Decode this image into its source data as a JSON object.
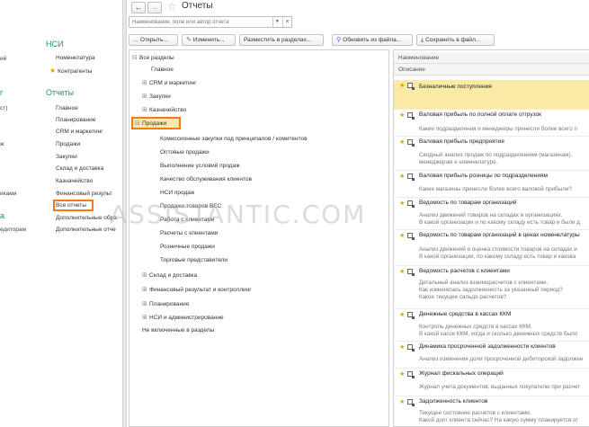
{
  "left_nav": {
    "stubs": [
      "ий",
      "г",
      "ст)",
      "ж",
      "иками",
      "а",
      "едиторам"
    ],
    "sections": [
      {
        "title": "НСИ",
        "items": [
          "Номенклатура",
          "Контрагенты"
        ]
      },
      {
        "title": "Отчеты",
        "items": [
          "Главное",
          "Планирование",
          "CRM и маркетинг",
          "Продажи",
          "Закупки",
          "Склад и доставка",
          "Казначейство",
          "Финансовый результ",
          "Все отчеты",
          "Дополнительные обра",
          "Дополнительные отче"
        ]
      }
    ]
  },
  "header": {
    "back_icon": "←",
    "forward_icon": "→",
    "star_icon": "☆",
    "title": "Отчеты"
  },
  "search": {
    "placeholder": "Наименование, поле или автор отчета",
    "dropdown_icon": "▼",
    "clear_icon": "×"
  },
  "toolbar": {
    "buttons": [
      {
        "icon": "...",
        "label": "Открыть..."
      },
      {
        "icon": "✎",
        "label": "Изменить..."
      },
      {
        "icon": "",
        "label": "Разместить в разделах..."
      },
      {
        "icon": "⚲",
        "label": "Обновить из файла..."
      },
      {
        "icon": "⤓",
        "label": "Сохранить в файл..."
      }
    ]
  },
  "tree": {
    "root": "Все разделы",
    "items": [
      {
        "label": "Главное",
        "expander": ""
      },
      {
        "label": "CRM и маркетинг",
        "expander": "⊞"
      },
      {
        "label": "Закупки",
        "expander": "⊞"
      },
      {
        "label": "Казначейство",
        "expander": "⊞"
      },
      {
        "label": "Продажи",
        "expander": "⊟"
      },
      {
        "label": "Комиссионные закупки под принципалов / комитентов",
        "expander": ""
      },
      {
        "label": "Оптовые продажи",
        "expander": ""
      },
      {
        "label": "Выполнение условий продаж",
        "expander": ""
      },
      {
        "label": "Качество обслуживания клиентов",
        "expander": ""
      },
      {
        "label": "НСИ продаж",
        "expander": ""
      },
      {
        "label": "Продажи товаров ВЕС",
        "expander": ""
      },
      {
        "label": "Работа с клиентами",
        "expander": ""
      },
      {
        "label": "Расчеты с клиентами",
        "expander": ""
      },
      {
        "label": "Розничные продажи",
        "expander": ""
      },
      {
        "label": "Торговые представители",
        "expander": ""
      },
      {
        "label": "Склад и доставка",
        "expander": "⊞"
      },
      {
        "label": "Финансовый результат и контроллинг",
        "expander": "⊞"
      },
      {
        "label": "Планирование",
        "expander": "⊞"
      },
      {
        "label": "НСИ и администрирование",
        "expander": "⊞"
      },
      {
        "label": "Не включенные в разделы",
        "expander": ""
      }
    ]
  },
  "reports": {
    "col_name": "Наименование",
    "col_desc": "Описание",
    "items": [
      {
        "title": "Безналичные поступления",
        "desc": []
      },
      {
        "title": "Валовая прибыль по полной оплате отгрузок",
        "desc": [
          "Какие подразделения и менеджеры принесли более всего п"
        ]
      },
      {
        "title": "Валовая прибыль предприятия",
        "desc": [
          "Сводный анализ продаж по подразделениям (магазинам),",
          "менеджерам и номенклатуре."
        ]
      },
      {
        "title": "Валовая прибыль розницы по подразделениям",
        "desc": [
          "Какие магазины принесли более всего валовой прибыли?"
        ]
      },
      {
        "title": "Ведомость по товарам организаций",
        "desc": [
          "Анализ движений товаров на складах и организациях.",
          "В какой организации и по какому складу есть товар и были д"
        ]
      },
      {
        "title": "Ведомость по товарам организаций в ценах номенклатуры",
        "desc": [
          "Анализ движений и оценка стоимости товаров на складах и",
          "В какой организации, по какому складу есть товар и какова"
        ]
      },
      {
        "title": "Ведомость расчетов с клиентами",
        "desc": [
          "Детальный анализ взаиморасчетов с клиентами.",
          "Как изменялась задолженность за указанный период?",
          "Какое текущее сальдо расчетов?"
        ]
      },
      {
        "title": "Денежные средства в кассах ККМ",
        "desc": [
          "Контроль денежных средств в кассах ККМ.",
          "В какой кассе ККМ, когда и сколько денежных средств было"
        ]
      },
      {
        "title": "Динамика просроченной задолженности клиентов",
        "desc": [
          "Анализ изменения доли просроченной дебиторской задолжен"
        ]
      },
      {
        "title": "Журнал фискальных операций",
        "desc": [
          "Журнал учета документов, выданных покупателю при расчет"
        ]
      },
      {
        "title": "Задолженность клиентов",
        "desc": [
          "Текущее состояние расчетов с клиентами.",
          "Какой долг клиента сейчас? На какую сумму планируется от"
        ]
      }
    ]
  },
  "watermark": "ASSISTANTIC.COM"
}
